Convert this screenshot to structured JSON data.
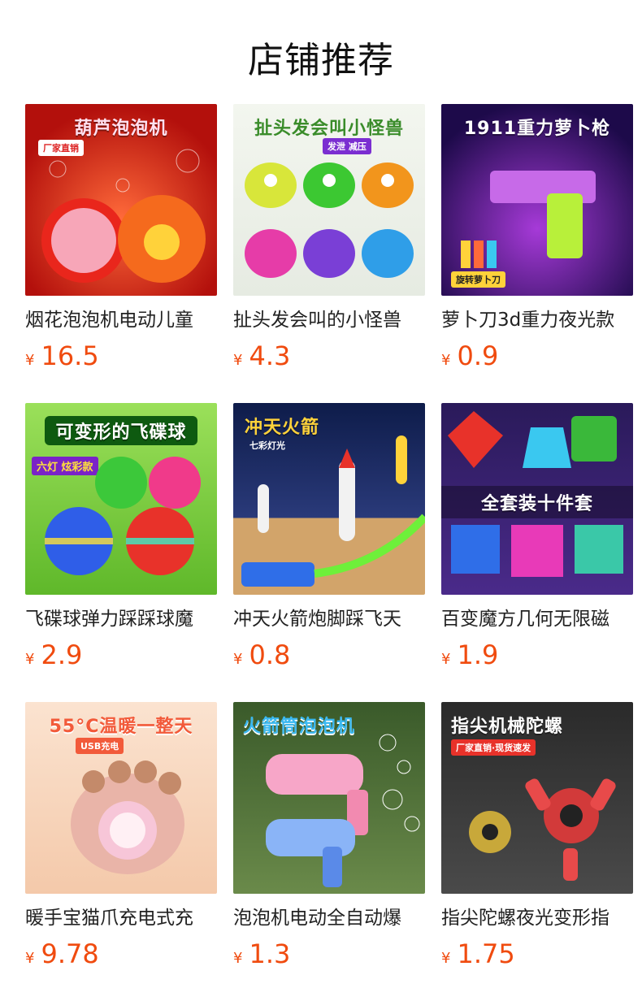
{
  "page_title": "店铺推荐",
  "currency": "¥",
  "products": [
    {
      "name": "烟花泡泡机电动儿童",
      "price": "16.5",
      "banner": "葫芦泡泡机",
      "tag": "厂家直销",
      "icon": "bubble-machine-icon"
    },
    {
      "name": "扯头发会叫的小怪兽",
      "price": "4.3",
      "banner": "扯头发会叫小怪兽",
      "tag": "发泄 减压",
      "icon": "monster-toy-icon"
    },
    {
      "name": "萝卜刀3d重力夜光款",
      "price": "0.9",
      "banner": "1911重力萝卜枪",
      "tag": "旋转萝卜刀",
      "icon": "toy-gun-icon"
    },
    {
      "name": "飞碟球弹力踩踩球魔",
      "price": "2.9",
      "banner": "可变形的飞碟球",
      "tag": "六灯 炫彩款",
      "icon": "ufo-ball-icon"
    },
    {
      "name": "冲天火箭炮脚踩飞天",
      "price": "0.8",
      "banner": "冲天火箭",
      "tag": "七彩灯光",
      "icon": "rocket-icon"
    },
    {
      "name": "百变魔方几何无限磁",
      "price": "1.9",
      "banner": "全套装十件套",
      "tag": "",
      "icon": "magic-cube-icon"
    },
    {
      "name": "暖手宝猫爪充电式充",
      "price": "9.78",
      "banner": "55°C温暖一整天",
      "tag": "USB充电",
      "icon": "hand-warmer-icon"
    },
    {
      "name": "泡泡机电动全自动爆",
      "price": "1.3",
      "banner": "火箭筒泡泡机",
      "tag": "",
      "icon": "bubble-gun-icon"
    },
    {
      "name": "指尖陀螺夜光变形指",
      "price": "1.75",
      "banner": "指尖机械陀螺",
      "tag": "厂家直销·现货速发",
      "icon": "fidget-spinner-icon"
    }
  ]
}
